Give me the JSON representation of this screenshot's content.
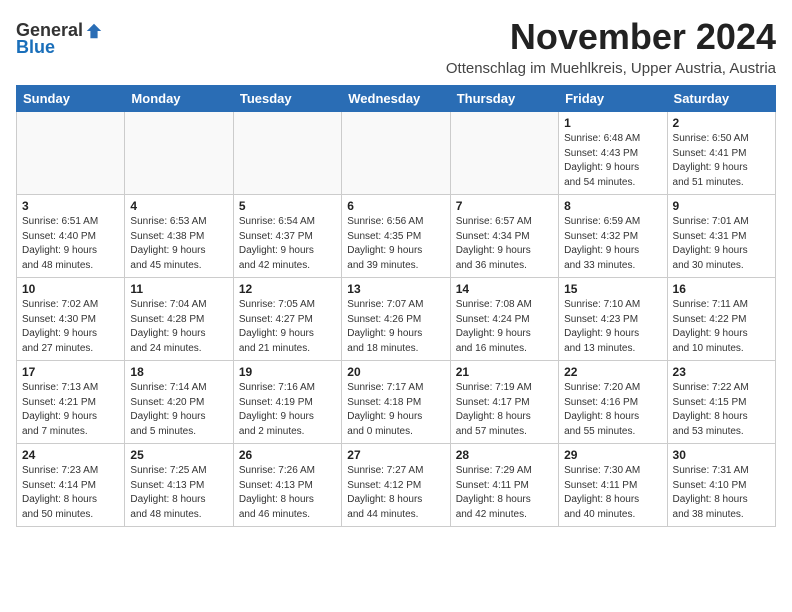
{
  "header": {
    "logo_general": "General",
    "logo_blue": "Blue",
    "title": "November 2024",
    "location": "Ottenschlag im Muehlkreis, Upper Austria, Austria"
  },
  "weekdays": [
    "Sunday",
    "Monday",
    "Tuesday",
    "Wednesday",
    "Thursday",
    "Friday",
    "Saturday"
  ],
  "weeks": [
    [
      {
        "day": "",
        "info": ""
      },
      {
        "day": "",
        "info": ""
      },
      {
        "day": "",
        "info": ""
      },
      {
        "day": "",
        "info": ""
      },
      {
        "day": "",
        "info": ""
      },
      {
        "day": "1",
        "info": "Sunrise: 6:48 AM\nSunset: 4:43 PM\nDaylight: 9 hours\nand 54 minutes."
      },
      {
        "day": "2",
        "info": "Sunrise: 6:50 AM\nSunset: 4:41 PM\nDaylight: 9 hours\nand 51 minutes."
      }
    ],
    [
      {
        "day": "3",
        "info": "Sunrise: 6:51 AM\nSunset: 4:40 PM\nDaylight: 9 hours\nand 48 minutes."
      },
      {
        "day": "4",
        "info": "Sunrise: 6:53 AM\nSunset: 4:38 PM\nDaylight: 9 hours\nand 45 minutes."
      },
      {
        "day": "5",
        "info": "Sunrise: 6:54 AM\nSunset: 4:37 PM\nDaylight: 9 hours\nand 42 minutes."
      },
      {
        "day": "6",
        "info": "Sunrise: 6:56 AM\nSunset: 4:35 PM\nDaylight: 9 hours\nand 39 minutes."
      },
      {
        "day": "7",
        "info": "Sunrise: 6:57 AM\nSunset: 4:34 PM\nDaylight: 9 hours\nand 36 minutes."
      },
      {
        "day": "8",
        "info": "Sunrise: 6:59 AM\nSunset: 4:32 PM\nDaylight: 9 hours\nand 33 minutes."
      },
      {
        "day": "9",
        "info": "Sunrise: 7:01 AM\nSunset: 4:31 PM\nDaylight: 9 hours\nand 30 minutes."
      }
    ],
    [
      {
        "day": "10",
        "info": "Sunrise: 7:02 AM\nSunset: 4:30 PM\nDaylight: 9 hours\nand 27 minutes."
      },
      {
        "day": "11",
        "info": "Sunrise: 7:04 AM\nSunset: 4:28 PM\nDaylight: 9 hours\nand 24 minutes."
      },
      {
        "day": "12",
        "info": "Sunrise: 7:05 AM\nSunset: 4:27 PM\nDaylight: 9 hours\nand 21 minutes."
      },
      {
        "day": "13",
        "info": "Sunrise: 7:07 AM\nSunset: 4:26 PM\nDaylight: 9 hours\nand 18 minutes."
      },
      {
        "day": "14",
        "info": "Sunrise: 7:08 AM\nSunset: 4:24 PM\nDaylight: 9 hours\nand 16 minutes."
      },
      {
        "day": "15",
        "info": "Sunrise: 7:10 AM\nSunset: 4:23 PM\nDaylight: 9 hours\nand 13 minutes."
      },
      {
        "day": "16",
        "info": "Sunrise: 7:11 AM\nSunset: 4:22 PM\nDaylight: 9 hours\nand 10 minutes."
      }
    ],
    [
      {
        "day": "17",
        "info": "Sunrise: 7:13 AM\nSunset: 4:21 PM\nDaylight: 9 hours\nand 7 minutes."
      },
      {
        "day": "18",
        "info": "Sunrise: 7:14 AM\nSunset: 4:20 PM\nDaylight: 9 hours\nand 5 minutes."
      },
      {
        "day": "19",
        "info": "Sunrise: 7:16 AM\nSunset: 4:19 PM\nDaylight: 9 hours\nand 2 minutes."
      },
      {
        "day": "20",
        "info": "Sunrise: 7:17 AM\nSunset: 4:18 PM\nDaylight: 9 hours\nand 0 minutes."
      },
      {
        "day": "21",
        "info": "Sunrise: 7:19 AM\nSunset: 4:17 PM\nDaylight: 8 hours\nand 57 minutes."
      },
      {
        "day": "22",
        "info": "Sunrise: 7:20 AM\nSunset: 4:16 PM\nDaylight: 8 hours\nand 55 minutes."
      },
      {
        "day": "23",
        "info": "Sunrise: 7:22 AM\nSunset: 4:15 PM\nDaylight: 8 hours\nand 53 minutes."
      }
    ],
    [
      {
        "day": "24",
        "info": "Sunrise: 7:23 AM\nSunset: 4:14 PM\nDaylight: 8 hours\nand 50 minutes."
      },
      {
        "day": "25",
        "info": "Sunrise: 7:25 AM\nSunset: 4:13 PM\nDaylight: 8 hours\nand 48 minutes."
      },
      {
        "day": "26",
        "info": "Sunrise: 7:26 AM\nSunset: 4:13 PM\nDaylight: 8 hours\nand 46 minutes."
      },
      {
        "day": "27",
        "info": "Sunrise: 7:27 AM\nSunset: 4:12 PM\nDaylight: 8 hours\nand 44 minutes."
      },
      {
        "day": "28",
        "info": "Sunrise: 7:29 AM\nSunset: 4:11 PM\nDaylight: 8 hours\nand 42 minutes."
      },
      {
        "day": "29",
        "info": "Sunrise: 7:30 AM\nSunset: 4:11 PM\nDaylight: 8 hours\nand 40 minutes."
      },
      {
        "day": "30",
        "info": "Sunrise: 7:31 AM\nSunset: 4:10 PM\nDaylight: 8 hours\nand 38 minutes."
      }
    ]
  ]
}
